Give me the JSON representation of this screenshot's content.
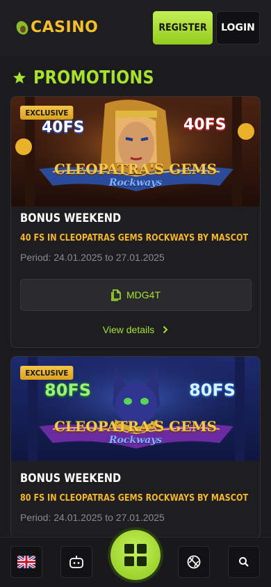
{
  "header": {
    "logo_text": "CASINO",
    "register_label": "REGISTER",
    "login_label": "LOGIN"
  },
  "section": {
    "title": "PROMOTIONS"
  },
  "promotions": [
    {
      "badge": "EXCLUSIVE",
      "banner_fs_label": "40FS",
      "banner_game_title": "CLEOPATRA'S GEMS",
      "banner_game_subtitle": "Rockways",
      "title": "BONUS WEEKEND",
      "subtitle": "40 FS IN CLEOPATRAS GEMS ROCKWAYS BY MASCOT",
      "period": "Period: 24.01.2025 to 27.01.2025",
      "promo_code": "MDG4T",
      "details_label": "View details"
    },
    {
      "badge": "EXCLUSIVE",
      "banner_fs_label": "80FS",
      "banner_game_title": "CLEOPATRA'S GEMS",
      "banner_game_subtitle": "Rockways",
      "title": "BONUS WEEKEND",
      "subtitle": "80 FS IN CLEOPATRAS GEMS ROCKWAYS BY MASCOT",
      "period": "Period: 24.01.2025 to 27.01.2025"
    }
  ],
  "bottom_nav": {
    "items": [
      "language-flag-uk",
      "games-icon",
      "menu-grid-icon",
      "sports-icon",
      "search-icon"
    ]
  },
  "colors": {
    "accent": "#a6e22e",
    "gold": "#f2b62d",
    "background": "#1b1b1d"
  }
}
